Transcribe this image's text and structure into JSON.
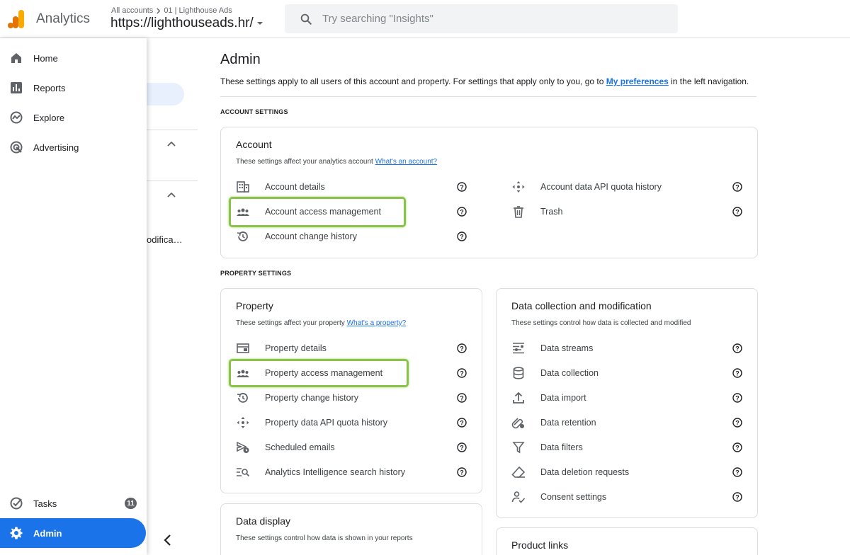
{
  "topbar": {
    "app_title": "Analytics",
    "breadcrumb_all": "All accounts",
    "breadcrumb_account": "01 | Lighthouse Ads",
    "property_name": "https://lighthouseads.hr/",
    "search_placeholder": "Try searching \"Insights\""
  },
  "leftnav": {
    "items": [
      {
        "label": "Home",
        "icon": "home-icon"
      },
      {
        "label": "Reports",
        "icon": "reports-icon"
      },
      {
        "label": "Explore",
        "icon": "explore-icon"
      },
      {
        "label": "Advertising",
        "icon": "advertising-icon"
      }
    ],
    "tasks_label": "Tasks",
    "tasks_count": "11",
    "admin_label": "Admin"
  },
  "secondary": {
    "truncated_item": "odifica…"
  },
  "main": {
    "title": "Admin",
    "desc_before": "These settings apply to all users of this account and property. For settings that apply only to you, go to ",
    "desc_link": "My preferences",
    "desc_after": " in the left navigation.",
    "account_section": "ACCOUNT SETTINGS",
    "property_section": "PROPERTY SETTINGS"
  },
  "account_card": {
    "title": "Account",
    "subtitle": "These settings affect your analytics account ",
    "subtitle_link": "What's an account?",
    "left_items": [
      "Account details",
      "Account access management",
      "Account change history"
    ],
    "right_items": [
      "Account data API quota history",
      "Trash"
    ]
  },
  "property_card": {
    "title": "Property",
    "subtitle": "These settings affect your property ",
    "subtitle_link": "What's a property?",
    "items": [
      "Property details",
      "Property access management",
      "Property change history",
      "Property data API quota history",
      "Scheduled emails",
      "Analytics Intelligence search history"
    ]
  },
  "data_collection_card": {
    "title": "Data collection and modification",
    "subtitle": "These settings control how data is collected and modified",
    "items": [
      "Data streams",
      "Data collection",
      "Data import",
      "Data retention",
      "Data filters",
      "Data deletion requests",
      "Consent settings"
    ]
  },
  "data_display_card": {
    "title": "Data display",
    "subtitle": "These settings control how data is shown in your reports"
  },
  "product_links_card": {
    "title": "Product links"
  },
  "colors": {
    "accent": "#1a73e8",
    "highlight": "#8bc34a",
    "icon": "#5f6368"
  }
}
